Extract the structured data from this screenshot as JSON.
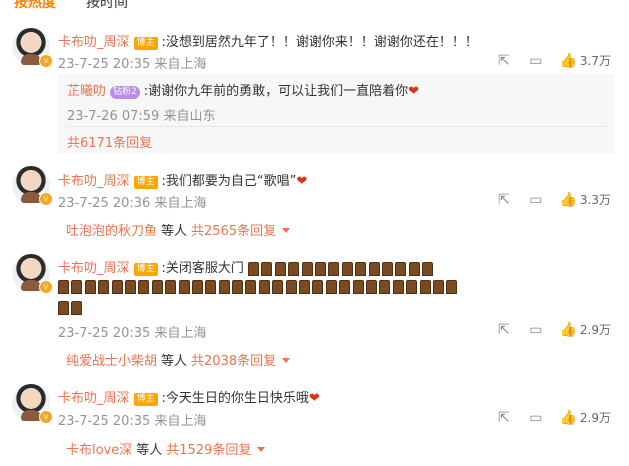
{
  "tabs": [
    {
      "label": "按热度"
    },
    {
      "label": "按时间"
    }
  ],
  "comments": [
    {
      "user": "卡布叻_周深",
      "badge": "博主",
      "text": ":没想到居然九年了！！谢谢你来！！谢谢你还在！！！",
      "time": "23-7-25 20:35 来自上海",
      "likes": "3.7万",
      "reply": {
        "user": "芷曦叻",
        "fan_badge": "钻粉2",
        "text": ":谢谢你九年前的勇敢，可以让我们一直陪着你",
        "time": "23-7-26 07:59 来自山东",
        "more": "共6171条回复"
      }
    },
    {
      "user": "卡布叻_周深",
      "badge": "博主",
      "text": ":我们都要为自己“歌唱”",
      "time": "23-7-25 20:36 来自上海",
      "likes": "3.3万",
      "summary": {
        "who": "吐泡泡的秋刀鱼",
        "deng": "等人",
        "count": "共2565条回复"
      }
    },
    {
      "user": "卡布叻_周深",
      "badge": "博主",
      "text": ":关闭客服大门",
      "door_emoji_count": 46,
      "time": "23-7-25 20:35 来自上海",
      "likes": "2.9万",
      "summary": {
        "who": "纯爱战士小柴胡",
        "deng": "等人",
        "count": "共2038条回复"
      }
    },
    {
      "user": "卡布叻_周深",
      "badge": "博主",
      "text": ":今天生日的你生日快乐哦",
      "time": "23-7-25 20:35 来自上海",
      "likes": "2.9万",
      "summary": {
        "who": "卡布love深",
        "deng": "等人",
        "count": "共1529条回复"
      }
    }
  ],
  "icons": {
    "share": "share-icon",
    "comment": "comment-icon",
    "like": "like-icon",
    "heart": "heart-emoji",
    "door": "door-emoji"
  },
  "colors": {
    "accent": "#ff8200",
    "username": "#eb7350",
    "meta": "#939393",
    "reply_bg": "#f7f7f7"
  }
}
